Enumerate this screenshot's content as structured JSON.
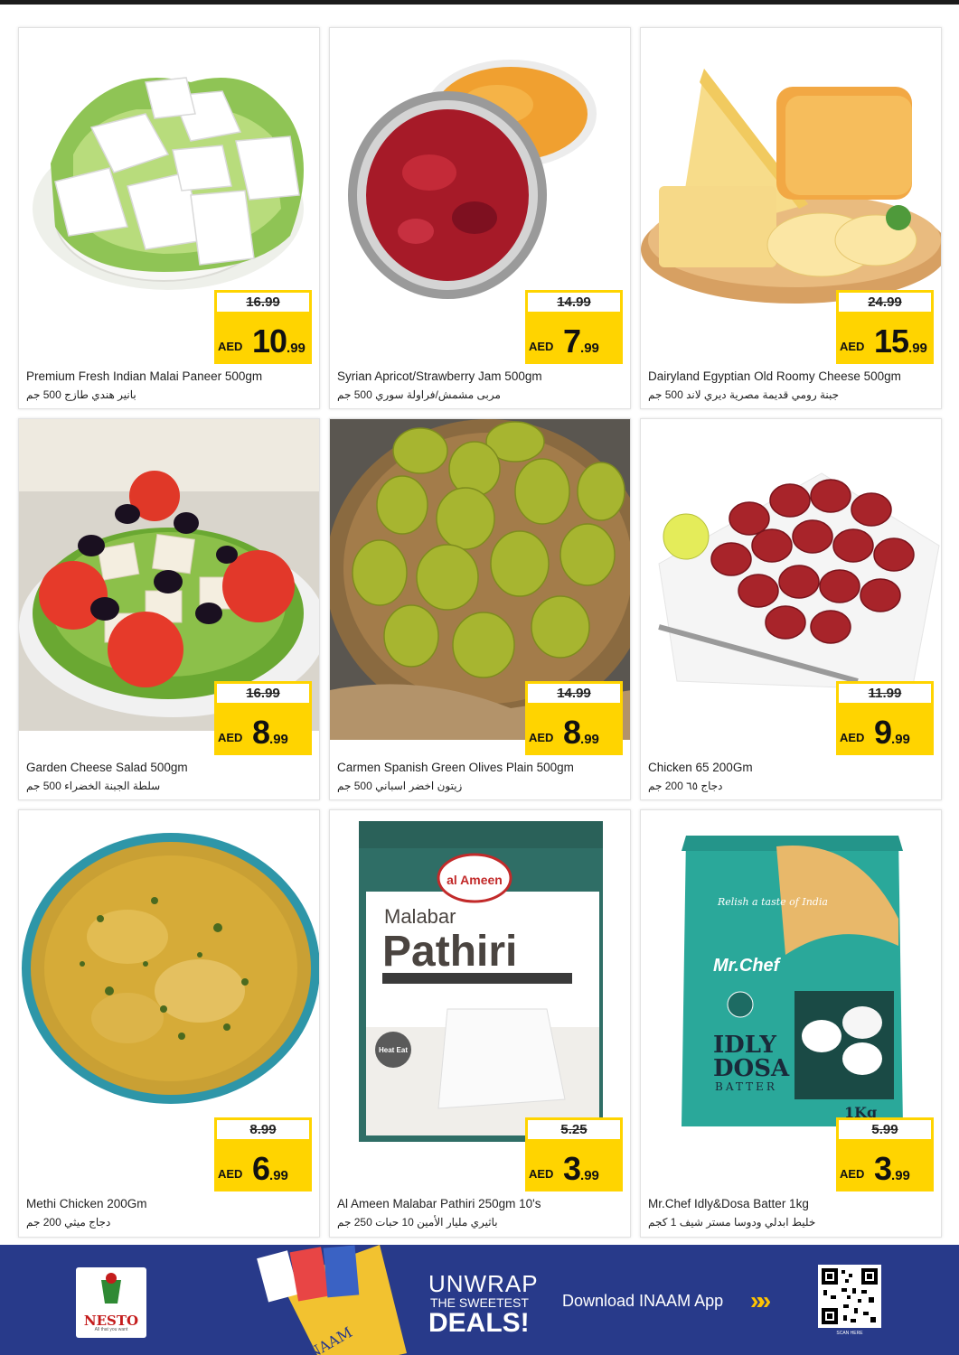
{
  "products": [
    {
      "name_en": "Premium Fresh Indian Malai Paneer 500gm",
      "name_ar": "بانير هندي طازج 500 جم",
      "old_price": "16.99",
      "currency": "AED",
      "price_main": "10",
      "price_dec": ".99",
      "image": "paneer-cubes-image"
    },
    {
      "name_en": "Syrian Apricot/Strawberry Jam 500gm",
      "name_ar": "مربى مشمش/فراولة سوري 500 جم",
      "old_price": "14.99",
      "currency": "AED",
      "price_main": "7",
      "price_dec": ".99",
      "image": "jam-bowls-image"
    },
    {
      "name_en": "Dairyland Egyptian Old Roomy Cheese 500gm",
      "name_ar": "جبنة رومي قديمة مصرية ديري لاند 500 جم",
      "old_price": "24.99",
      "currency": "AED",
      "price_main": "15",
      "price_dec": ".99",
      "image": "roomy-cheese-image"
    },
    {
      "name_en": "Garden Cheese Salad 500gm",
      "name_ar": "سلطة الجبنة الخضراء 500 جم",
      "old_price": "16.99",
      "currency": "AED",
      "price_main": "8",
      "price_dec": ".99",
      "image": "cheese-salad-image"
    },
    {
      "name_en": "Carmen Spanish Green Olives Plain 500gm",
      "name_ar": "زيتون اخضر اسباني 500 جم",
      "old_price": "14.99",
      "currency": "AED",
      "price_main": "8",
      "price_dec": ".99",
      "image": "green-olives-image"
    },
    {
      "name_en": "Chicken 65 200Gm",
      "name_ar": "دجاج ٦٥ 200 جم",
      "old_price": "11.99",
      "currency": "AED",
      "price_main": "9",
      "price_dec": ".99",
      "image": "chicken-65-image"
    },
    {
      "name_en": "Methi Chicken 200Gm",
      "name_ar": "دجاج ميثي 200 جم",
      "old_price": "8.99",
      "currency": "AED",
      "price_main": "6",
      "price_dec": ".99",
      "image": "methi-chicken-image"
    },
    {
      "name_en": "Al Ameen Malabar Pathiri 250gm 10's",
      "name_ar": "باثيري مليار الأمين 10 حبات 250 جم",
      "old_price": "5.25",
      "currency": "AED",
      "price_main": "3",
      "price_dec": ".99",
      "image": "pathiri-pack-image"
    },
    {
      "name_en": "Mr.Chef Idly&Dosa Batter 1kg",
      "name_ar": "خليط ابدلي ودوسا مستر شيف 1 كجم",
      "old_price": "5.99",
      "currency": "AED",
      "price_main": "3",
      "price_dec": ".99",
      "image": "idly-batter-pack-image"
    }
  ],
  "pack_text": {
    "ameen_logo": "al Ameen",
    "malabar": "Malabar",
    "pathiri": "Pathiri",
    "heat_eat": "Heat Eat",
    "relish": "Relish a taste of India",
    "mrchef": "Mr.Chef",
    "idly": "IDLY",
    "dosa": "DOSA",
    "batter": "BATTER",
    "weight": "1Kg"
  },
  "footer": {
    "logo_text": "NESTO",
    "logo_sub": "All that you want",
    "app_badge": "INAAM",
    "unwrap": "UNWRAP",
    "sweetest": "THE SWEETEST",
    "deals": "DEALS!",
    "download": "Download INAAM App",
    "chevrons": "»»",
    "qr_caption": "SCAN HERE"
  },
  "colors": {
    "price_yellow": "#ffd400",
    "footer_blue": "#283a8a",
    "chevron_gold": "#ffc400"
  }
}
